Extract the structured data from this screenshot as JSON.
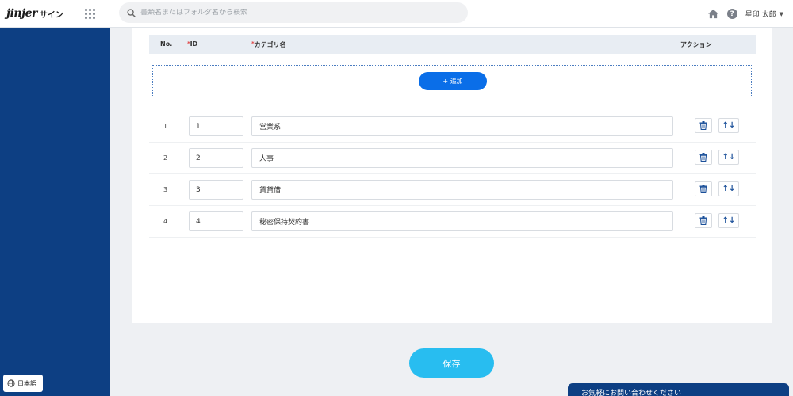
{
  "brand": {
    "logo_main": "jinjer",
    "logo_sub": "サイン"
  },
  "search": {
    "placeholder": "書類名またはフォルダ名から検索"
  },
  "user": {
    "name": "星印 太郎"
  },
  "language": {
    "label": "日本語"
  },
  "table": {
    "headers": {
      "no": "No.",
      "id": "ID",
      "name": "カテゴリ名",
      "action": "アクション"
    },
    "required_mark": "*",
    "rows": [
      {
        "no": "1",
        "id": "1",
        "name": "営業系"
      },
      {
        "no": "2",
        "id": "2",
        "name": "人事"
      },
      {
        "no": "3",
        "id": "3",
        "name": "賃貸借"
      },
      {
        "no": "4",
        "id": "4",
        "name": "秘密保持契約書"
      }
    ]
  },
  "actions": {
    "add_label": "+ 追加",
    "save_label": "保存",
    "sort_glyph": "↑↓"
  },
  "chat": {
    "label": "お気軽にお問い合わせください"
  },
  "colors": {
    "sidebar": "#0d3f83",
    "primary": "#0a6ee8",
    "save": "#28bdf0"
  },
  "icons": [
    "search-icon",
    "home-icon",
    "help-icon",
    "caret-down-icon",
    "apps-grid-icon",
    "globe-icon",
    "trash-icon",
    "sort-arrows-icon"
  ]
}
